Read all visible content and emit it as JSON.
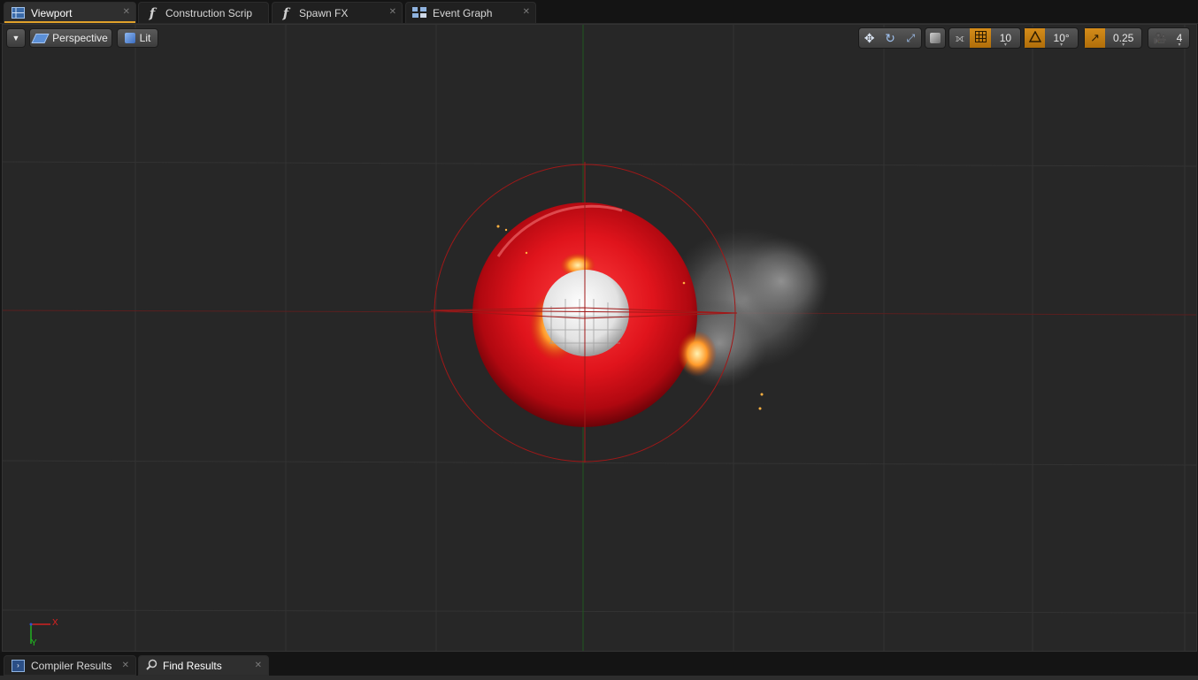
{
  "tabs": [
    {
      "label": "Viewport",
      "icon": "viewport-grid-icon",
      "active": true
    },
    {
      "label": "Construction Scrip",
      "icon": "function-icon",
      "active": false
    },
    {
      "label": "Spawn FX",
      "icon": "function-icon",
      "active": false
    },
    {
      "label": "Event Graph",
      "icon": "event-graph-icon",
      "active": false
    }
  ],
  "viewport": {
    "view_mode": "Perspective",
    "lighting": "Lit",
    "grid_snap": "10",
    "rotation_snap": "10°",
    "scale_snap": "0.25",
    "camera_speed": "4",
    "axis_x": "X",
    "axis_y": "Y"
  },
  "bottom_tabs": [
    {
      "label": "Compiler Results",
      "icon": "compiler-icon",
      "active": false
    },
    {
      "label": "Find Results",
      "icon": "search-icon",
      "active": true
    }
  ],
  "colors": {
    "accent": "#e0a12a",
    "snap_orange": "#c47e12",
    "viewport_bg": "#272727",
    "ring_red": "#d8121a"
  }
}
